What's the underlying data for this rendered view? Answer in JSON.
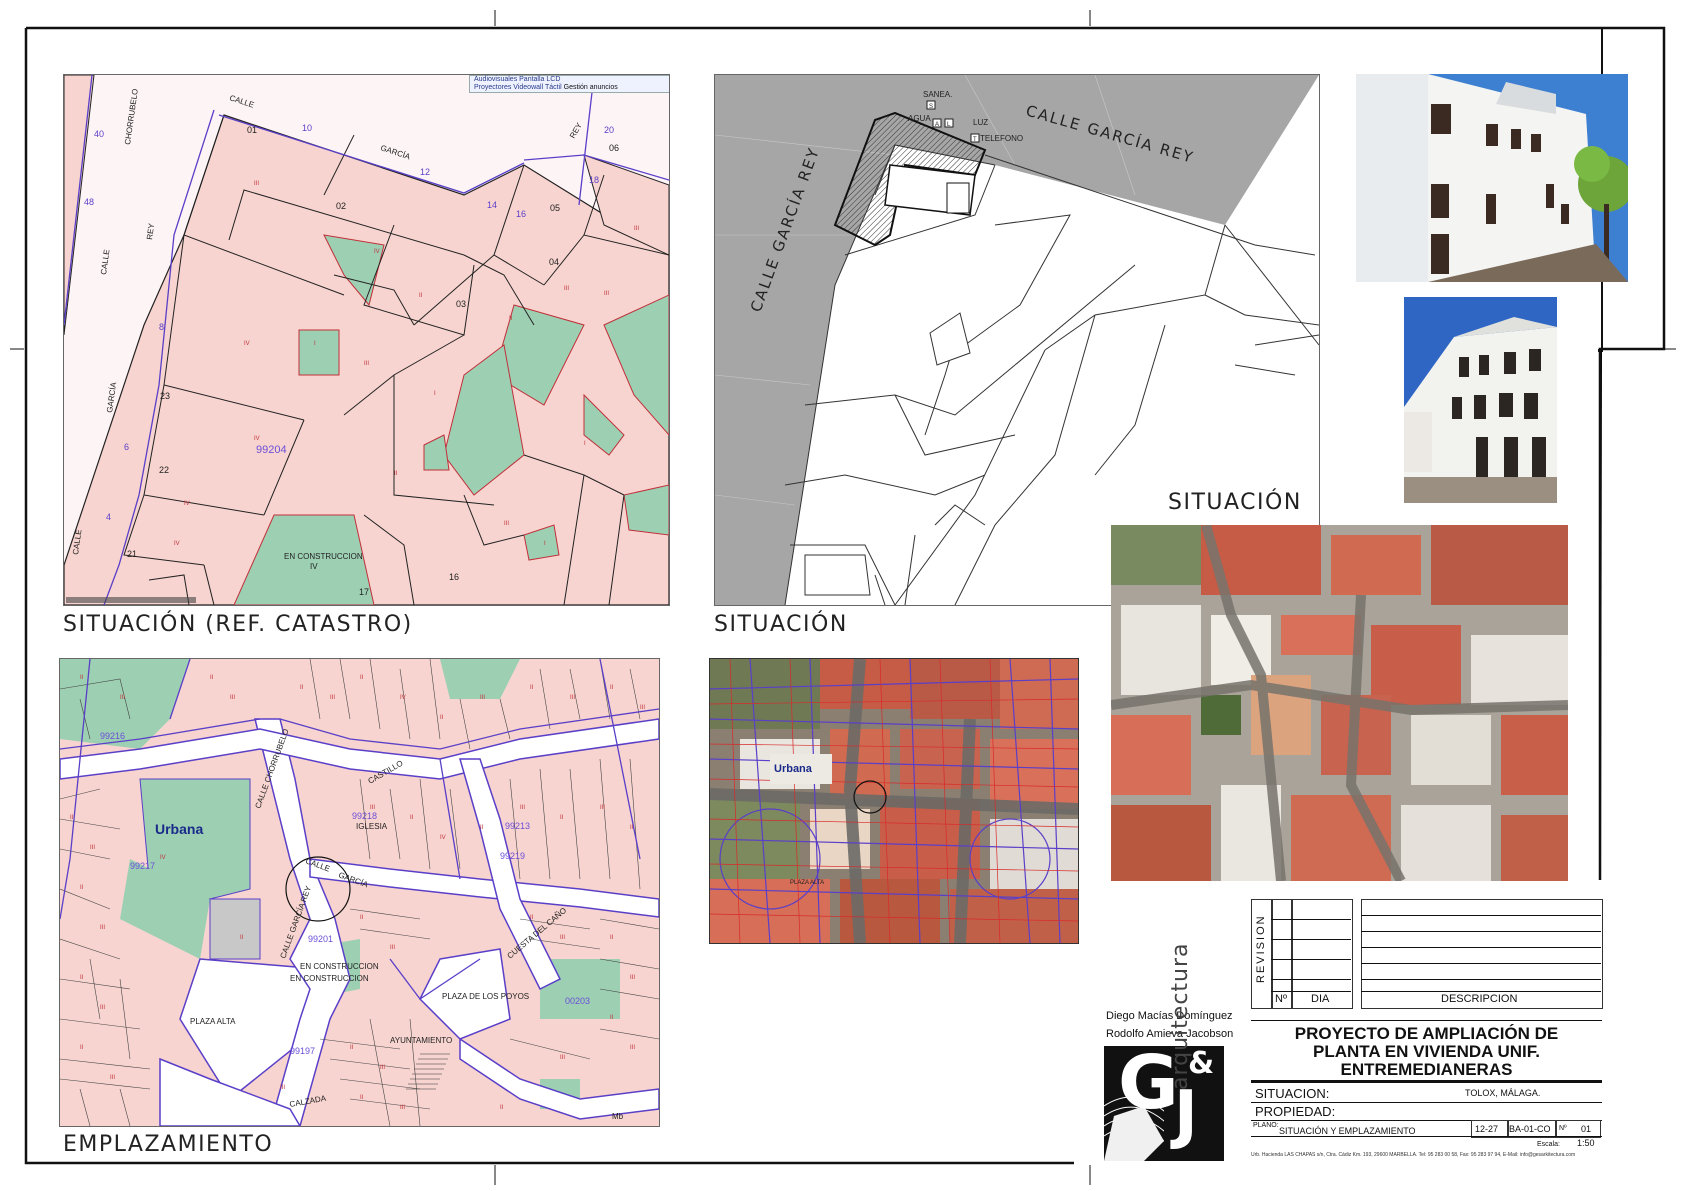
{
  "map_catastro": {
    "ad_line1": "Audiovisuales Pantalla LCD",
    "ad_line2": "Proyectores Videowall Táctil",
    "ad_link": "Gestión anuncios",
    "street_calle_top": "CALLE",
    "street_garcia": "GARCÍA",
    "street_rey_top": "REY",
    "street_calle_left": "CALLE",
    "street_rey_left": "REY",
    "street_garcia_left": "GARCÍA",
    "street_calle_bottom": "CALLE",
    "street_chorrubelo": "CHORRUBELO",
    "parcel_01": "01",
    "parcel_02": "02",
    "parcel_03": "03",
    "parcel_04": "04",
    "parcel_05": "05",
    "parcel_06": "06",
    "parcel_16": "16",
    "parcel_17": "17",
    "parcel_21": "21",
    "parcel_22": "22",
    "parcel_23": "23",
    "block_id": "99204",
    "construction": "EN CONSTRUCCION",
    "construction_level": "IV",
    "num_10": "10",
    "num_12": "12",
    "num_14": "14",
    "num_16": "16",
    "num_18": "18",
    "num_20": "20",
    "num_40": "40",
    "num_48": "48",
    "num_8": "8",
    "num_6": "6",
    "num_4": "4"
  },
  "map_situacion": {
    "street_right": "CALLE GARCÍA REY",
    "street_left": "CALLE GARCÍA REY",
    "sanea": "SANEA.",
    "sanea_code": "S",
    "agua": "AGUA",
    "agua_code": "A",
    "luz_code": "L",
    "luz": "LUZ",
    "tel_code": "T",
    "telefono": "TELEFONO"
  },
  "map_emplazamiento": {
    "urbana": "Urbana",
    "iglesia": "IGLESIA",
    "plaza_alta": "PLAZA ALTA",
    "plaza_pollos": "PLAZA DE LOS POYOS",
    "ayuntamiento": "AYUNTAMIENTO",
    "block_99218": "99218",
    "block_99216": "99216",
    "block_99217": "99217",
    "block_99201": "99201",
    "block_99197": "99197",
    "block_99213": "99213",
    "block_99219": "99219",
    "block_00203": "00203",
    "street_garcia": "GARCÍA",
    "street_calle": "CALLE",
    "street_castillo": "CASTILLO",
    "street_cuesta": "CUESTA DEL CAÑO",
    "street_calle_chorrubelo": "CALLE CHORRUBELO",
    "street_calle_garcia_rey": "CALLE GARCÍA REY",
    "street_calzada": "CALZADA",
    "en_construccion": "EN CONSTRUCCION",
    "en_construccion2": "EN CONSTRUCCION",
    "corner": "Mb"
  },
  "map_aerial_small": {
    "urbana": "Urbana",
    "plaza_alta": "PLAZA ALTA"
  },
  "captions": {
    "catastro": "SITUACIÓN (REF. CATASTRO)",
    "situacion": "SITUACIÓN",
    "situacion_right": "SITUACIÓN",
    "emplazamiento": "EMPLAZAMIENTO"
  },
  "revision": {
    "label": "REVISION",
    "col_num": "Nº",
    "col_dia": "DIA",
    "col_desc": "DESCRIPCION"
  },
  "authors": {
    "author1": "Diego Macías Domínguez",
    "author2": "Rodolfo Amieva Jacobson",
    "logo_letters_top": "G",
    "logo_amp": "&",
    "logo_letters_bottom": "J",
    "logo_side": "arquitectura"
  },
  "title_block": {
    "title_line1": "PROYECTO DE AMPLIACIÓN DE",
    "title_line2": "PLANTA EN VIVIENDA UNIF.",
    "title_line3": "ENTREMEDIANERAS",
    "situacion_label": "SITUACION:",
    "situacion_value": "TOLOX, MÁLAGA.",
    "propiedad_label": "PROPIEDAD:",
    "plano_label": "PLANO:",
    "plano_value": "SITUACIÓN Y EMPLAZAMIENTO",
    "date": "12-27",
    "code": "BA-01-CO",
    "num_label": "Nº",
    "num_value": "01",
    "escala_label": "Escala:",
    "escala_value": "1:50",
    "address": "Urb. Hacienda LAS CHAPAS s/n, Ctra. Cádiz Km. 193, 29600 MARBELLA.  Tel: 95 283 00 58,  Fax: 95 283 97 94,  E-Mail: info@gesarkitectura.com"
  },
  "colors": {
    "parcel_pink": "#f7d4cf",
    "parcel_green": "#9dcfb3",
    "cadastre_purple": "#5a3fc8",
    "parcel_red": "#c0303a",
    "street_gray": "#a6a6a6",
    "frame": "#111111"
  }
}
